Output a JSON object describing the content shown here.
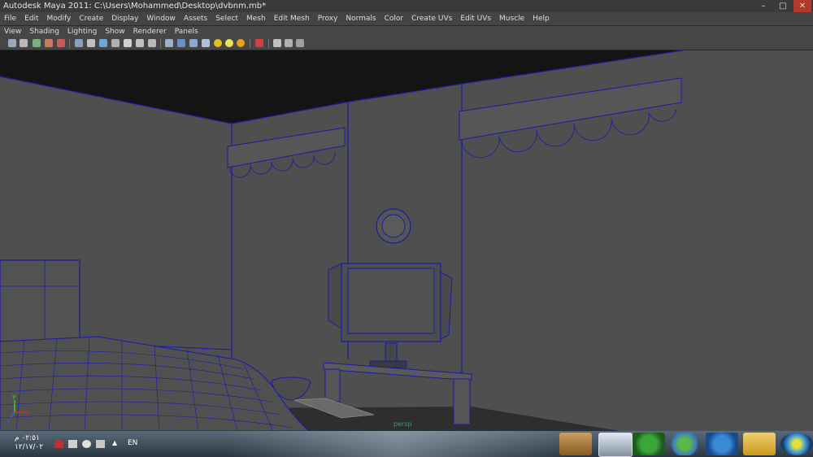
{
  "window": {
    "title": "Autodesk Maya 2011: C:\\Users\\Mohammed\\Desktop\\dvbnm.mb*"
  },
  "menubar": [
    "File",
    "Edit",
    "Modify",
    "Create",
    "Display",
    "Window",
    "Assets",
    "Select",
    "Mesh",
    "Edit Mesh",
    "Proxy",
    "Normals",
    "Color",
    "Create UVs",
    "Edit UVs",
    "Muscle",
    "Help"
  ],
  "panel_menu": [
    "View",
    "Shading",
    "Lighting",
    "Show",
    "Renderer",
    "Panels"
  ],
  "viewport": {
    "camera": "persp",
    "axis_labels": {
      "y": "y",
      "x": "x",
      "z": "z"
    }
  },
  "taskbar": {
    "clock_time": "٠٢:٥١ م",
    "clock_date": "١٢/١٧/٠٢",
    "language": "EN",
    "tray_arrow": "▲",
    "apps": [
      "paint-app-icon",
      "maya-app-icon",
      "utorrent-icon",
      "messenger-icon",
      "maxthon-icon",
      "folder-icon",
      "windows-start-icon"
    ]
  },
  "colors": {
    "wire": "#1a1aa8",
    "viewport_bg": "#4f4f4f",
    "ceiling": "#141414"
  }
}
